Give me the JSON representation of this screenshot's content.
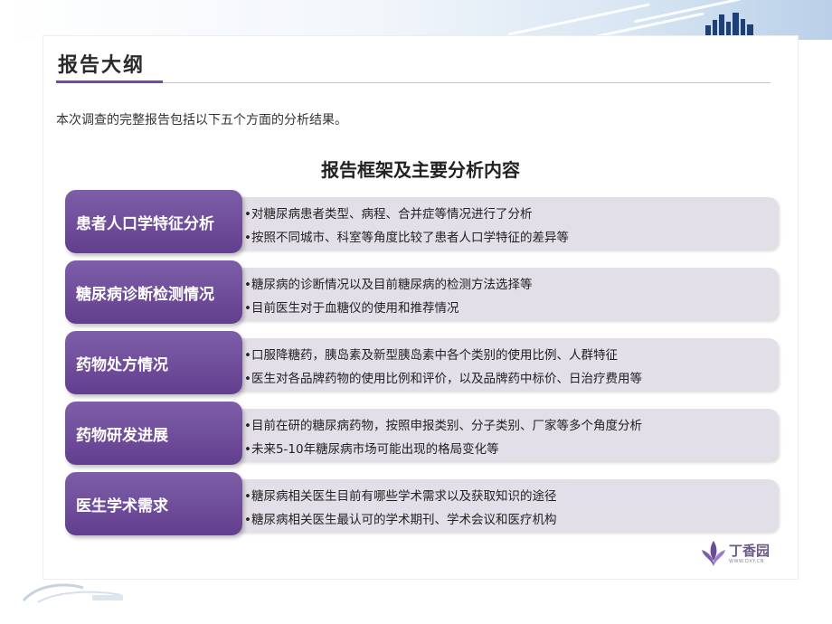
{
  "slide": {
    "title": "报告大纲",
    "intro": "本次调查的完整报告包括以下五个方面的分析结果。",
    "subtitle": "报告框架及主要分析内容"
  },
  "sections": [
    {
      "label": "患者人口学特征分析",
      "lines": [
        "•对糖尿病患者类型、病程、合并症等情况进行了分析",
        "•按照不同城市、科室等角度比较了患者人口学特征的差异等"
      ]
    },
    {
      "label": "糖尿病诊断检测情况",
      "lines": [
        "•糖尿病的诊断情况以及目前糖尿病的检测方法选择等",
        "•目前医生对于血糖仪的使用和推荐情况"
      ]
    },
    {
      "label": "药物处方情况",
      "lines": [
        "•口服降糖药，胰岛素及新型胰岛素中各个类别的使用比例、人群特征",
        "•医生对各品牌药物的使用比例和评价，以及品牌药中标价、日治疗费用等"
      ]
    },
    {
      "label": "药物研发进展",
      "lines": [
        "•目前在研的糖尿病药物，按照申报类别、分子类别、厂家等多个角度分析",
        "•未来5-10年糖尿病市场可能出现的格局变化等"
      ]
    },
    {
      "label": "医生学术需求",
      "lines": [
        "•糖尿病相关医生目前有哪些学术需求以及获取知识的途径",
        "•糖尿病相关医生最认可的学术期刊、学术会议和医疗机构"
      ]
    }
  ],
  "logo": {
    "name": "丁香园",
    "url_text": "WWW.DXY.CN",
    "icon": "lilac-flower-icon",
    "color": "#7b5fa6"
  },
  "colors": {
    "label_bg": "#6f4f9a",
    "desc_bg": "#e3dfe8",
    "accent_line": "#6f4f9a"
  }
}
